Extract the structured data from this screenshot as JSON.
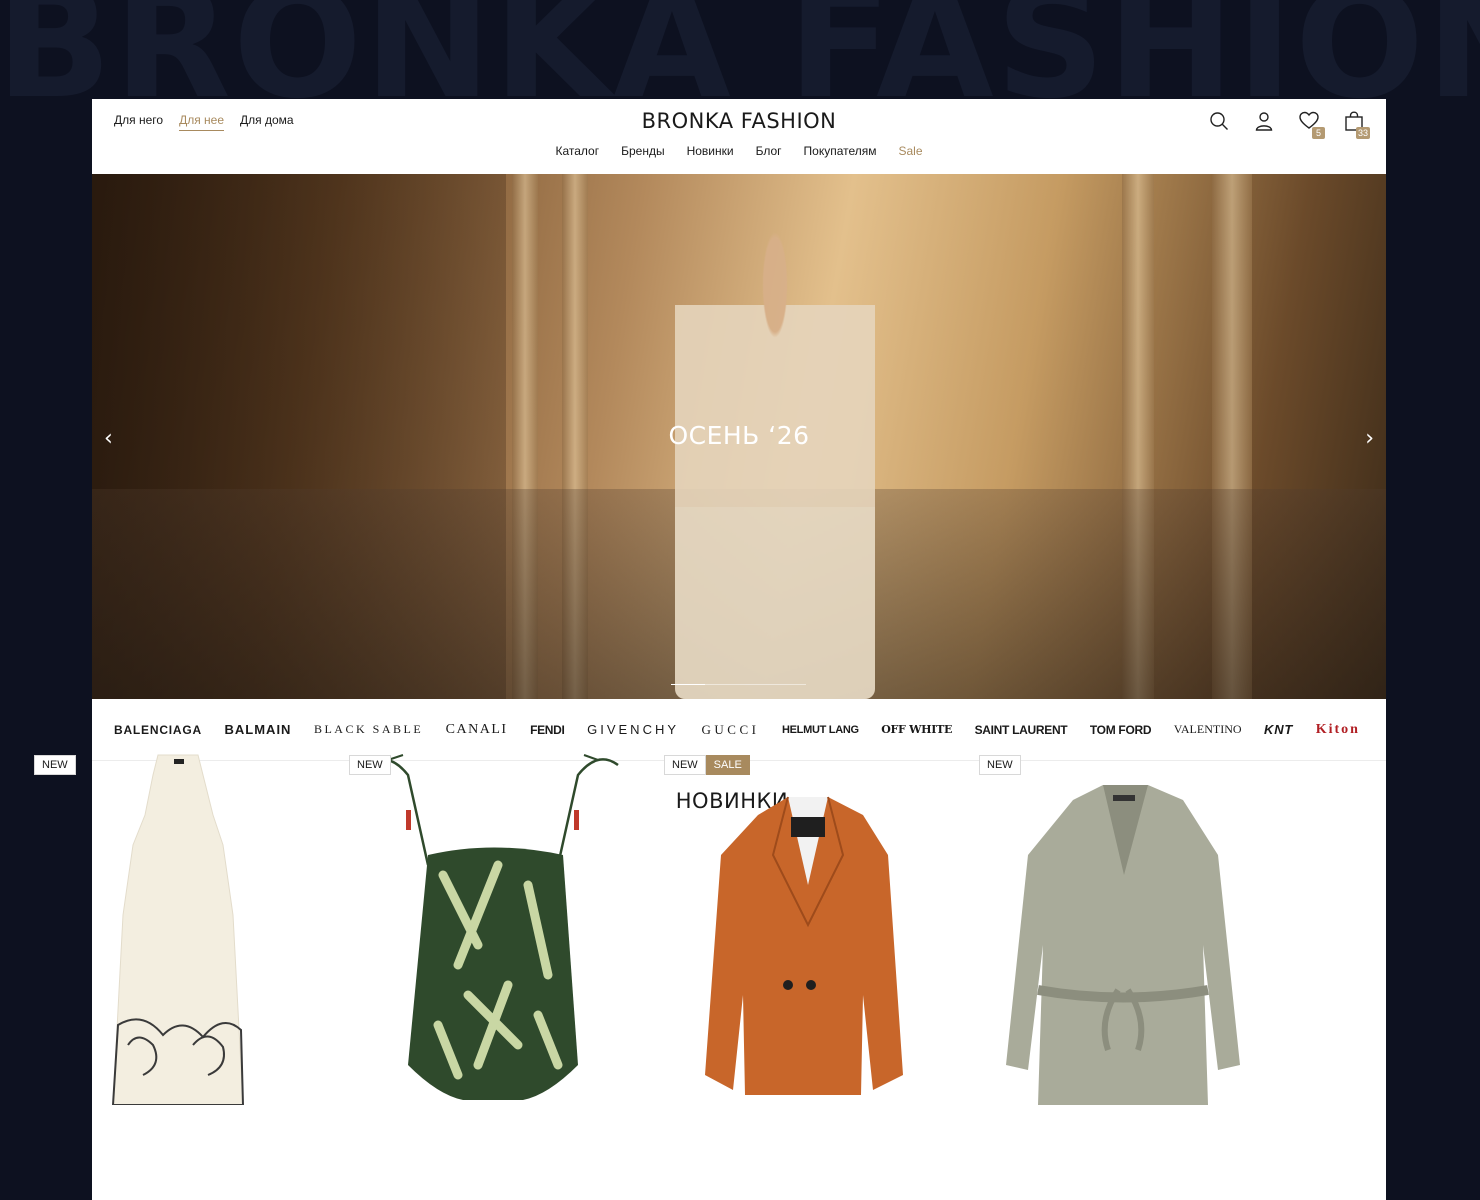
{
  "background_text": "BRONKA FASHION",
  "header": {
    "gender_nav": [
      {
        "label": "Для него",
        "active": false
      },
      {
        "label": "Для нее",
        "active": true
      },
      {
        "label": "Для дома",
        "active": false
      }
    ],
    "logo": "BRONKA FASHION",
    "main_nav": [
      "Каталог",
      "Бренды",
      "Новинки",
      "Блог",
      "Покупателям",
      "Sale"
    ],
    "icons": {
      "search": "search-icon",
      "account": "user-icon",
      "wishlist": {
        "icon": "heart-icon",
        "count": "5"
      },
      "cart": {
        "icon": "bag-icon",
        "count": "33"
      }
    }
  },
  "hero": {
    "title": "ОСЕНЬ ‘26",
    "prev_arrow": "‹",
    "next_arrow": "›",
    "slide_progress": 0.25
  },
  "brands": [
    "BALENCIAGA",
    "BALMAIN",
    "BLACK SABLE",
    "CANALI",
    "FENDI",
    "GIVENCHY",
    "GUCCI",
    "HELMUT LANG",
    "OFF WHITE",
    "SAINT LAURENT",
    "TOM FORD",
    "VALENTINO",
    "KNT",
    "Kiton"
  ],
  "new_section": {
    "title": "НОВИНКИ",
    "chevron": "›"
  },
  "products": [
    {
      "tags": [
        "NEW"
      ],
      "item": "dress",
      "colors": {
        "main": "#f3eee0",
        "accent": "#3a3a3a"
      }
    },
    {
      "tags": [
        "NEW"
      ],
      "item": "swimsuit",
      "colors": {
        "main": "#2f4a2c",
        "accent": "#c9d7a4"
      }
    },
    {
      "tags": [
        "NEW",
        "SALE"
      ],
      "item": "blazer",
      "colors": {
        "main": "#c8662a",
        "accent": "#1f1f1f"
      }
    },
    {
      "tags": [
        "NEW"
      ],
      "item": "jumpsuit",
      "colors": {
        "main": "#a9ab9a",
        "accent": "#8c8e7e"
      }
    }
  ],
  "accent_color": "#a88a5e"
}
